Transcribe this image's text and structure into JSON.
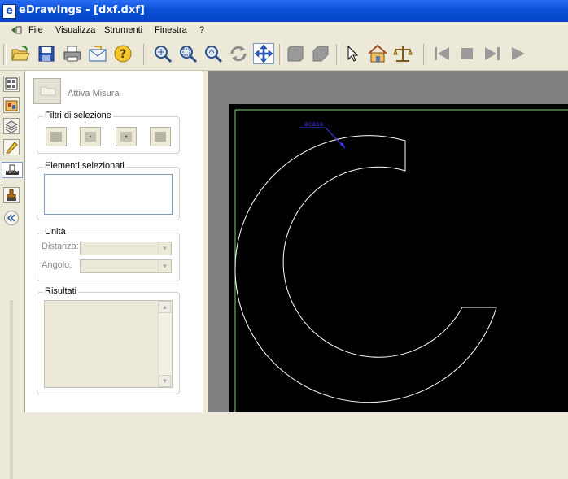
{
  "window": {
    "title": "eDrawings - [dxf.dxf]",
    "app_icon_letter": "e",
    "accent_color": "#0a4fd6"
  },
  "menu": {
    "items": [
      "File",
      "Visualizza",
      "Strumenti",
      "Finestra",
      "?"
    ]
  },
  "toolbar": {
    "buttons": [
      "open-icon",
      "save-icon",
      "print-icon",
      "send-icon",
      "help-icon",
      "zoom-fit-icon",
      "zoom-window-icon",
      "zoom-icon",
      "rotate-icon",
      "pan-icon",
      "shaded-icon",
      "shaded-edges-icon",
      "select-icon",
      "home-icon",
      "scale-icon",
      "first-frame-icon",
      "stop-icon",
      "next-frame-icon",
      "play-icon"
    ]
  },
  "sidebar": {
    "buttons": [
      "sheets-icon",
      "components-icon",
      "layers-icon",
      "markup-icon",
      "measure-icon",
      "stamp-icon",
      "collapse-icon"
    ],
    "selected": "measure-icon"
  },
  "measure_panel": {
    "activate_label": "Attiva Misura",
    "filters_title": "Filtri di selezione",
    "selected_title": "Elementi selezionati",
    "units_title": "Unità",
    "distance_label": "Distanza:",
    "angle_label": "Angolo:",
    "results_title": "Risultati",
    "distance_value": "",
    "angle_value": ""
  },
  "drawing": {
    "annotation_text": "acasa",
    "background": "#000000",
    "line_color": "#ffffff",
    "annotation_color": "#3c3cff"
  }
}
